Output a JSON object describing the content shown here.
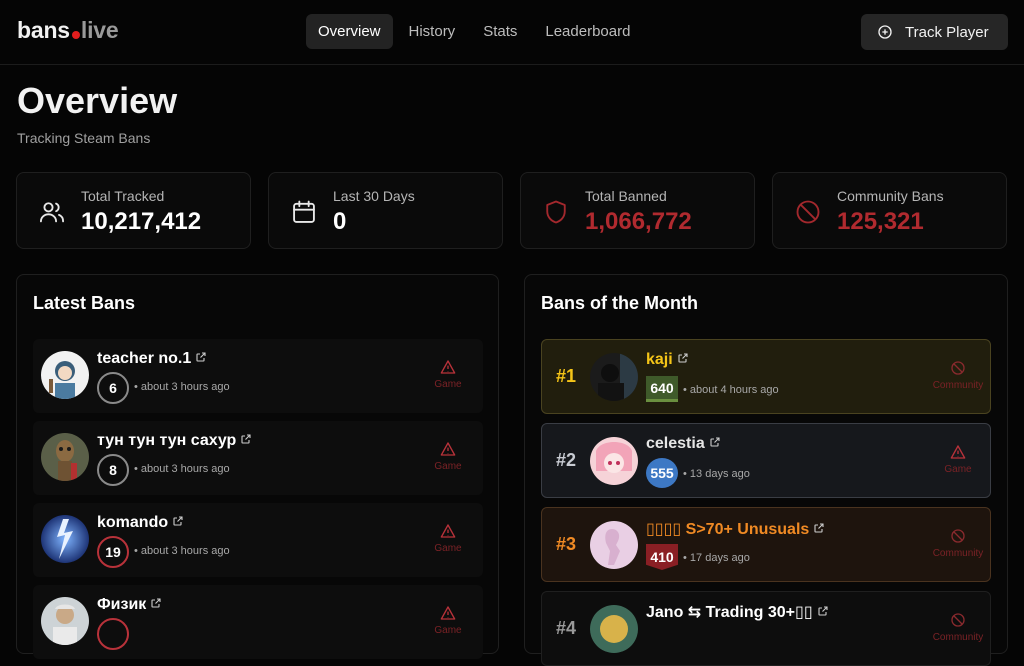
{
  "brand": {
    "name_part1": "bans",
    "name_part2": "live"
  },
  "nav": [
    {
      "label": "Overview",
      "active": true
    },
    {
      "label": "History",
      "active": false
    },
    {
      "label": "Stats",
      "active": false
    },
    {
      "label": "Leaderboard",
      "active": false
    }
  ],
  "track_button": {
    "label": "Track Player",
    "icon": "plus-circle-icon"
  },
  "page": {
    "title": "Overview",
    "subtitle": "Tracking Steam Bans"
  },
  "stats": [
    {
      "label": "Total Tracked",
      "value": "10,217,412",
      "icon": "users-icon"
    },
    {
      "label": "Last 30 Days",
      "value": "0",
      "icon": "calendar-icon"
    },
    {
      "label": "Total Banned",
      "value": "1,066,772",
      "icon": "shield-icon"
    },
    {
      "label": "Community Bans",
      "value": "125,321",
      "icon": "ban-icon"
    }
  ],
  "latest_bans": {
    "title": "Latest Bans",
    "items": [
      {
        "name": "teacher no.1",
        "level": "6",
        "time": "about 3 hours ago",
        "type": "Game"
      },
      {
        "name": "тун тун тун сахур",
        "level": "8",
        "time": "about 3 hours ago",
        "type": "Game"
      },
      {
        "name": "komando",
        "level": "19",
        "time": "about 3 hours ago",
        "type": "Game"
      },
      {
        "name": "Физик",
        "level": "",
        "time": "",
        "type": "Game"
      }
    ]
  },
  "bans_of_month": {
    "title": "Bans of the Month",
    "items": [
      {
        "rank": "#1",
        "name": "kaji",
        "level": "640",
        "time": "about 4 hours ago",
        "type": "Community"
      },
      {
        "rank": "#2",
        "name": "celestia",
        "level": "555",
        "time": "13 days ago",
        "type": "Game"
      },
      {
        "rank": "#3",
        "name": "▯▯▯▯ S>70+ Unusuals",
        "level": "410",
        "time": "17 days ago",
        "type": "Community"
      },
      {
        "rank": "#4",
        "name": "Jano ⇆ Trading 30+▯▯",
        "level": "",
        "time": "",
        "type": "Community"
      }
    ]
  },
  "colors": {
    "accent_red": "#b02a2f",
    "gold": "#f5c518",
    "silver": "#c9ccd3",
    "bronze": "#f08a24"
  }
}
